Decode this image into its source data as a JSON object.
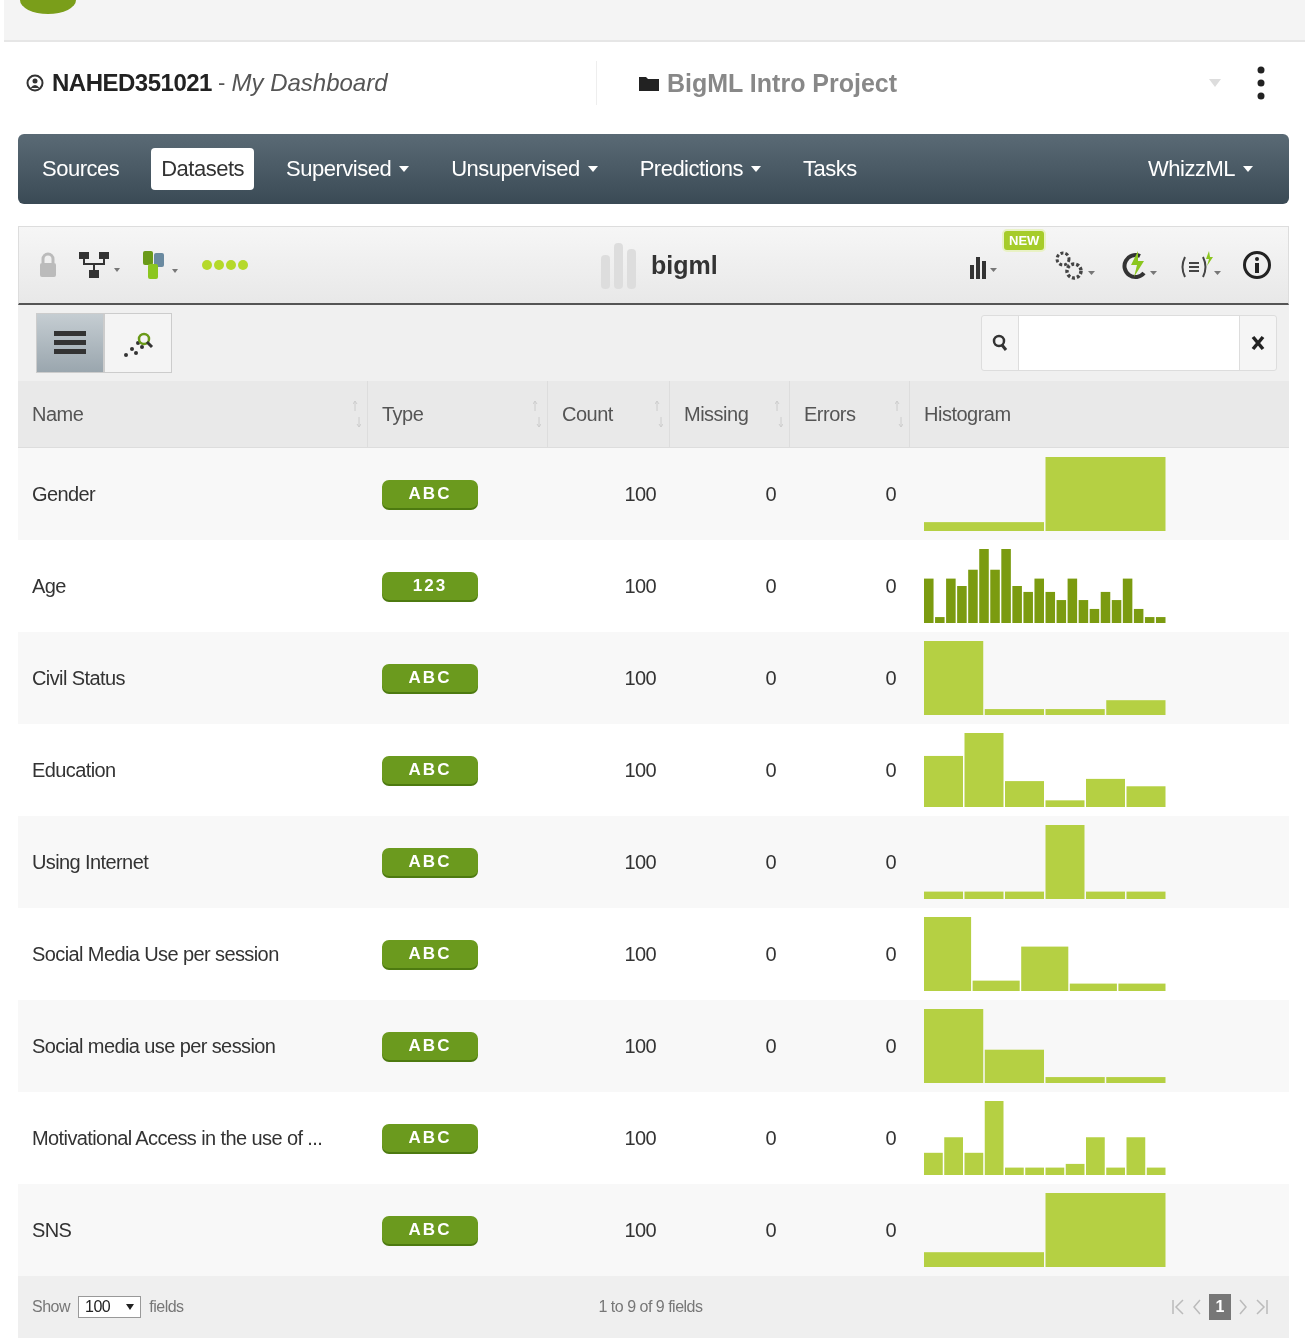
{
  "header": {
    "user": "NAHED351021",
    "separator": " - ",
    "dashboard": "My Dashboard",
    "project": "BigML Intro Project"
  },
  "nav": {
    "items": [
      {
        "label": "Sources",
        "selected": false,
        "dropdown": false
      },
      {
        "label": "Datasets",
        "selected": true,
        "dropdown": false
      },
      {
        "label": "Supervised",
        "selected": false,
        "dropdown": true
      },
      {
        "label": "Unsupervised",
        "selected": false,
        "dropdown": true
      },
      {
        "label": "Predictions",
        "selected": false,
        "dropdown": true
      },
      {
        "label": "Tasks",
        "selected": false,
        "dropdown": false
      }
    ],
    "right": {
      "label": "WhizzML",
      "dropdown": true
    }
  },
  "toolbar": {
    "title": "bigml",
    "badge": "NEW"
  },
  "view_toggle": [
    {
      "kind": "list",
      "selected": true
    },
    {
      "kind": "scatter",
      "selected": false
    }
  ],
  "table": {
    "columns": [
      {
        "label": "Name",
        "sortable": true
      },
      {
        "label": "Type",
        "sortable": true
      },
      {
        "label": "Count",
        "sortable": true
      },
      {
        "label": "Missing",
        "sortable": true
      },
      {
        "label": "Errors",
        "sortable": true
      },
      {
        "label": "Histogram",
        "sortable": false
      }
    ],
    "rows": [
      {
        "name": "Gender",
        "type": "ABC",
        "kind": "text",
        "count": "100",
        "missing": "0",
        "errors": "0"
      },
      {
        "name": "Age",
        "type": "123",
        "kind": "numeric",
        "count": "100",
        "missing": "0",
        "errors": "0"
      },
      {
        "name": "Civil Status",
        "type": "ABC",
        "kind": "text",
        "count": "100",
        "missing": "0",
        "errors": "0"
      },
      {
        "name": "Education",
        "type": "ABC",
        "kind": "text",
        "count": "100",
        "missing": "0",
        "errors": "0"
      },
      {
        "name": "Using Internet",
        "type": "ABC",
        "kind": "text",
        "count": "100",
        "missing": "0",
        "errors": "0"
      },
      {
        "name": "Social Media Use per session",
        "type": "ABC",
        "kind": "text",
        "count": "100",
        "missing": "0",
        "errors": "0"
      },
      {
        "name": "Social media use per session",
        "type": "ABC",
        "kind": "text",
        "count": "100",
        "missing": "0",
        "errors": "0"
      },
      {
        "name": "Motivational Access in the use of ...",
        "type": "ABC",
        "kind": "text",
        "count": "100",
        "missing": "0",
        "errors": "0"
      },
      {
        "name": "SNS",
        "type": "ABC",
        "kind": "text",
        "count": "100",
        "missing": "0",
        "errors": "0"
      }
    ]
  },
  "footer": {
    "show": "Show",
    "page_size": "100",
    "fields": "fields",
    "summary": "1 to 9 of 9 fields",
    "pages": [
      {
        "label": "1",
        "selected": true
      }
    ]
  }
}
